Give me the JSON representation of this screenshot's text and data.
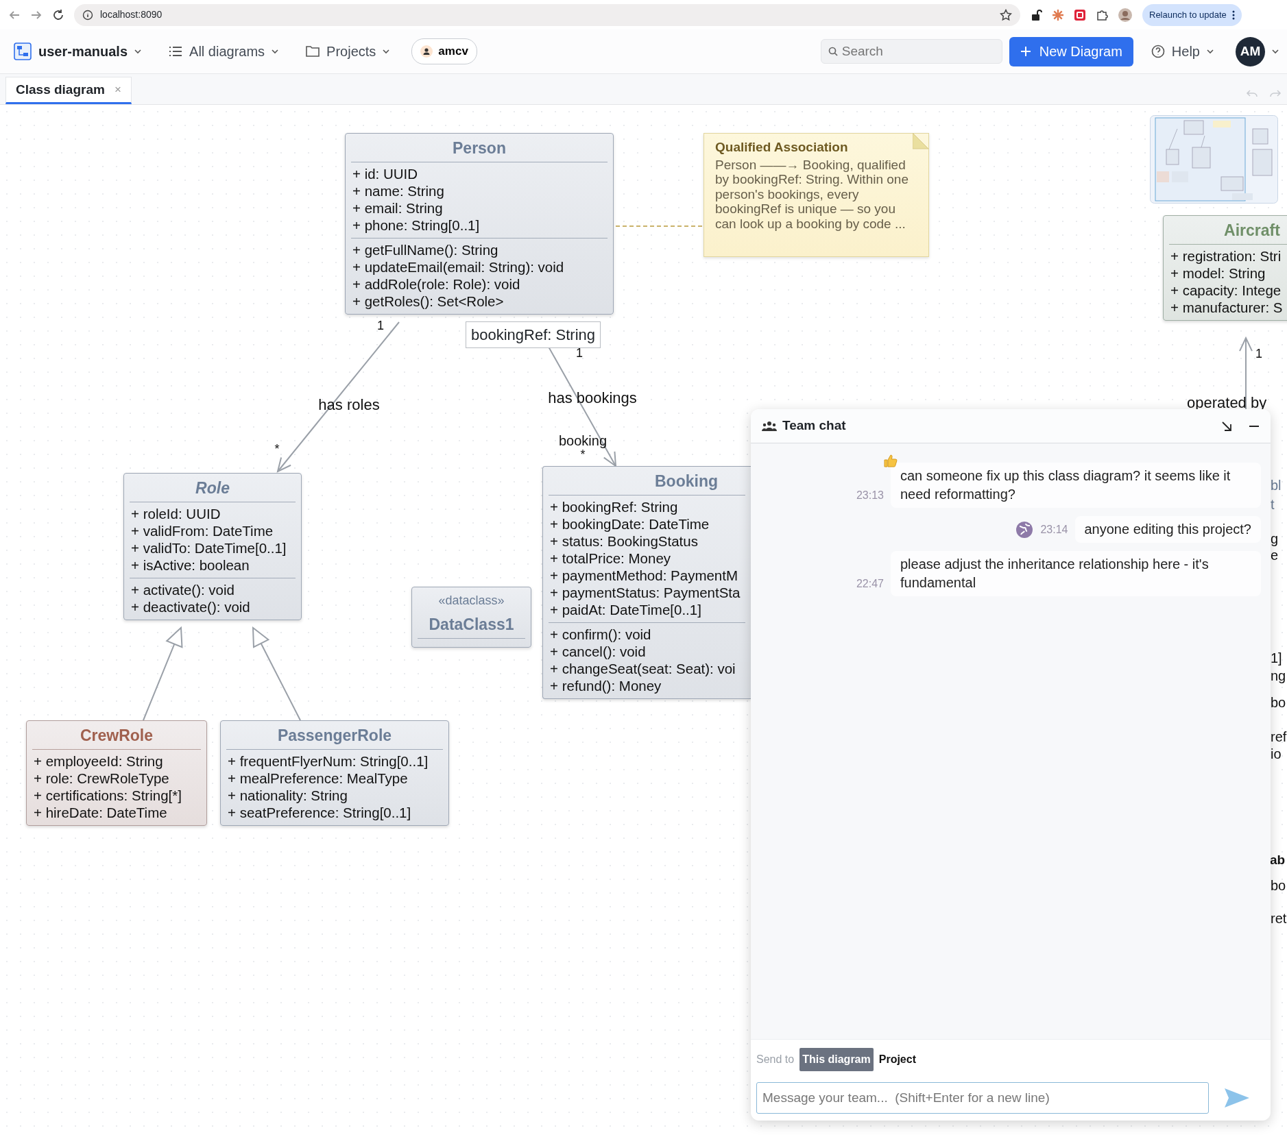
{
  "browser": {
    "url": "localhost:8090",
    "update_button": "Relaunch to update"
  },
  "app_bar": {
    "project": "user-manuals",
    "menus": [
      {
        "label": "All diagrams",
        "kind": "list"
      },
      {
        "label": "Projects",
        "kind": "folder"
      }
    ],
    "user_chip": "amcv",
    "search": {
      "placeholder": "Search"
    },
    "new_button": "New Diagram",
    "help": "Help",
    "avatar": "AM"
  },
  "tabs": [
    {
      "label": "Class diagram",
      "selected": true,
      "close": "×"
    }
  ],
  "diagram": {
    "classes": [
      {
        "name": "Person",
        "abstract": false,
        "color": "#6b7d96",
        "attributes": [
          "+ id: UUID",
          "+ name: String",
          "+ email: String",
          "+ phone: String[0..1]"
        ],
        "methods": [
          "+ getFullName(): String",
          "+ updateEmail(email: String): void",
          "+ addRole(role: Role): void",
          "+ getRoles(): Set<Role>"
        ]
      },
      {
        "name": "Aircraft",
        "abstract": false,
        "color": "#6f8f68",
        "attributes": [
          "+ registration: Stri",
          "+ model: String",
          "+ capacity: Intege",
          "+ manufacturer: S"
        ]
      },
      {
        "name": "Role",
        "abstract": true,
        "color": "#6b7d96",
        "attributes": [
          "+ roleId: UUID",
          "+ validFrom: DateTime",
          "+ validTo: DateTime[0..1]",
          "+ isActive: boolean"
        ],
        "methods": [
          "+ activate(): void",
          "+ deactivate(): void"
        ]
      },
      {
        "name": "DataClass1",
        "abstract": false,
        "stereotype": "«dataclass»",
        "color": "#6b7d96"
      },
      {
        "name": "Booking",
        "abstract": false,
        "color": "#6b7d96",
        "attributes": [
          "+ bookingRef: String",
          "+ bookingDate: DateTime",
          "+ status: BookingStatus",
          "+ totalPrice: Money",
          "+ paymentMethod: PaymentM",
          "+ paymentStatus: PaymentSta",
          "+ paidAt: DateTime[0..1]"
        ],
        "methods": [
          "+ confirm(): void",
          "+ cancel(): void",
          "+ changeSeat(seat: Seat): voi",
          "+ refund(): Money"
        ]
      },
      {
        "name": "CrewRole",
        "abstract": false,
        "color": "#a0604e",
        "attributes": [
          "+ employeeId: String",
          "+ role: CrewRoleType",
          "+ certifications: String[*]",
          "+ hireDate: DateTime"
        ]
      },
      {
        "name": "PassengerRole",
        "abstract": false,
        "color": "#6b7d96",
        "attributes": [
          "+ frequentFlyerNum: String[0..1]",
          "+ mealPreference: MealType",
          "+ nationality: String",
          "+ seatPreference: String[0..1]"
        ]
      }
    ],
    "note": {
      "title": "Qualified Association",
      "text": "Person ——→ Booking, qualified by bookingRef: String. Within one person's bookings, every bookingRef is unique — so you can look up a booking by code ..."
    },
    "qualifier": "bookingRef: String",
    "associations": [
      {
        "label": "has roles",
        "source_multiplicity": "1",
        "target_multiplicity": "*"
      },
      {
        "label": "has bookings",
        "source_multiplicity": "1",
        "target_role": "booking",
        "target_multiplicity": "*"
      },
      {
        "label": "operated by",
        "target_multiplicity": "1"
      }
    ],
    "fragments": [
      {
        "text": "bl",
        "kind": "title"
      },
      {
        "text": "t",
        "kind": "title"
      },
      {
        "text": "g",
        "kind": "member"
      },
      {
        "text": "e",
        "kind": "member"
      },
      {
        "text": "1]",
        "kind": "member"
      },
      {
        "text": "ng",
        "kind": "member"
      },
      {
        "text": "bo",
        "kind": "member"
      },
      {
        "text": "ref",
        "kind": "member"
      },
      {
        "text": "io",
        "kind": "member"
      },
      {
        "text": "ab",
        "kind": "name"
      },
      {
        "text": "bo",
        "kind": "member"
      },
      {
        "text": "ret",
        "kind": "member"
      }
    ]
  },
  "chat": {
    "title": "Team chat",
    "messages": [
      {
        "text": "can someone fix up this class diagram? it seems like it need reformatting?",
        "time": "23:13",
        "mine": false,
        "reaction": true
      },
      {
        "text": "anyone editing this project?",
        "time": "23:14",
        "mine": true
      },
      {
        "text": "please adjust the inheritance relationship here - it's fundamental",
        "time": "22:47",
        "mine": false
      }
    ],
    "send_to": {
      "label": "Send to",
      "options": [
        {
          "label": "This diagram",
          "selected": true
        },
        {
          "label": "Project",
          "selected": false
        }
      ]
    },
    "input": {
      "placeholder": "Message your team...  (Shift+Enter for a new line)"
    }
  }
}
